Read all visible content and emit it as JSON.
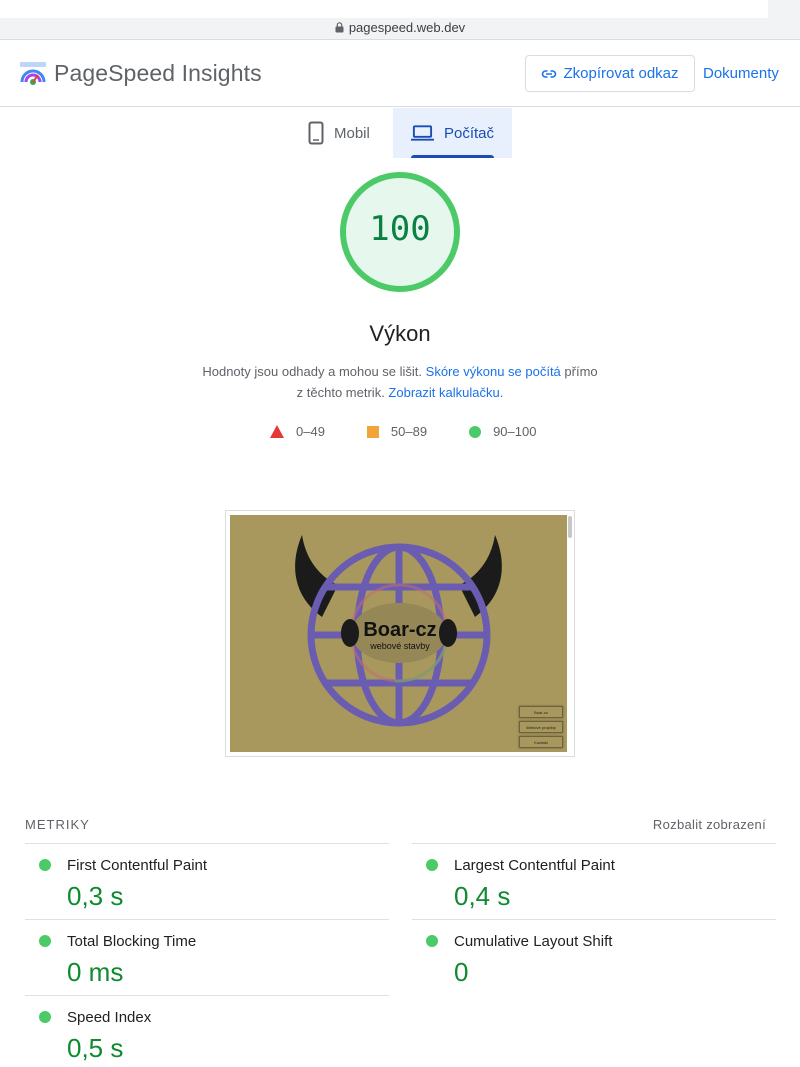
{
  "browser": {
    "url": "pagespeed.web.dev"
  },
  "header": {
    "app_title": "PageSpeed Insights",
    "copy_link_label": "Zkopírovat odkaz",
    "docs_label": "Dokumenty"
  },
  "tabs": [
    {
      "label": "Mobil",
      "icon": "smartphone-icon",
      "selected": false
    },
    {
      "label": "Počítač",
      "icon": "laptop-icon",
      "selected": true
    }
  ],
  "score": {
    "value": "100",
    "fraction": 1.0,
    "color": "#0cce6b",
    "category": "Výkon",
    "desc_part1": "Hodnoty jsou odhady a mohou se lišit. ",
    "desc_link1": "Skóre výkonu se počítá",
    "desc_part2": " přímo",
    "desc_part3": "z těchto metrik. ",
    "desc_link2": "Zobrazit kalkulačku."
  },
  "legend": [
    {
      "label": "0–49",
      "shape": "triangle",
      "color": "#e53935"
    },
    {
      "label": "50–89",
      "shape": "square",
      "color": "#f2a33a"
    },
    {
      "label": "90–100",
      "shape": "circle",
      "color": "#4cca67"
    }
  ],
  "screenshot": {
    "brand": "Boar-cz",
    "subtitle": "webové stavby",
    "buttons": [
      "Boar-cz",
      "Webové projekty",
      "Kontakt"
    ]
  },
  "metrics": {
    "heading": "METRIKY",
    "expand_label": "Rozbalit zobrazení",
    "items": [
      {
        "name": "First Contentful Paint",
        "value": "0,3 s",
        "status": "good"
      },
      {
        "name": "Largest Contentful Paint",
        "value": "0,4 s",
        "status": "good"
      },
      {
        "name": "Total Blocking Time",
        "value": "0 ms",
        "status": "good"
      },
      {
        "name": "Cumulative Layout Shift",
        "value": "0",
        "status": "good"
      },
      {
        "name": "Speed Index",
        "value": "0,5 s",
        "status": "good"
      }
    ]
  }
}
